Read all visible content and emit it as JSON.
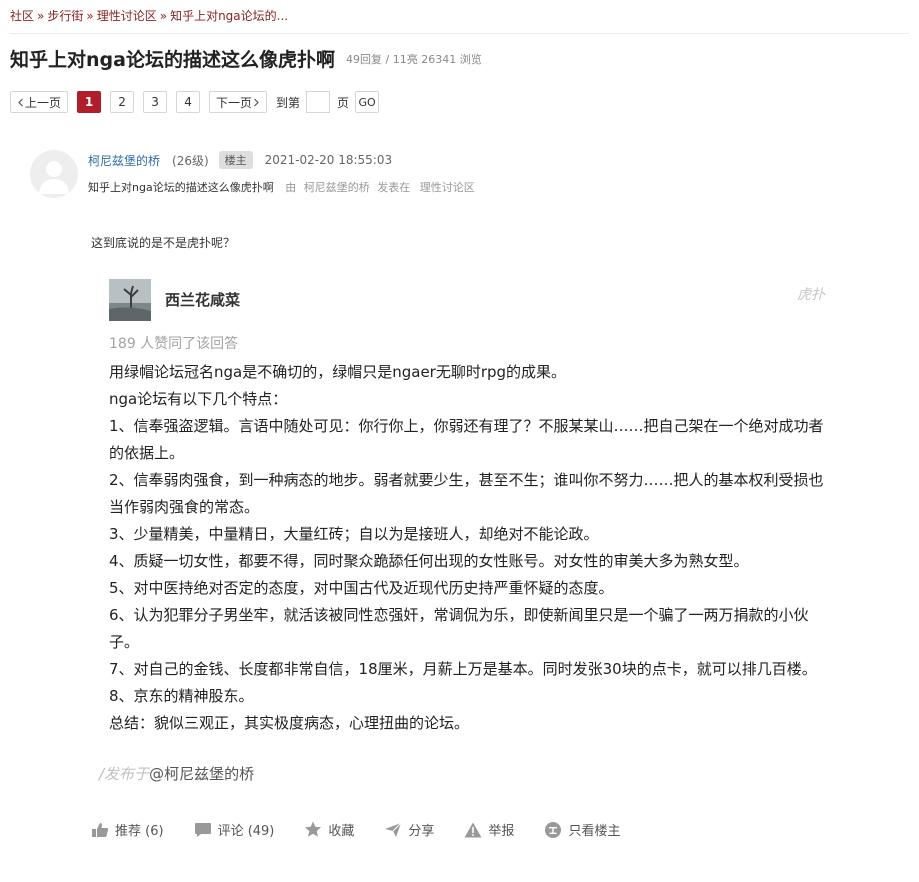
{
  "breadcrumb": {
    "items": [
      "社区",
      "步行街",
      "理性讨论区",
      "知乎上对nga论坛的..."
    ],
    "separator": "»"
  },
  "thread": {
    "title": "知乎上对nga论坛的描述这么像虎扑啊",
    "stats": "49回复 / 11亮 26341 浏览"
  },
  "pager": {
    "prev": "上一页",
    "pages": [
      "1",
      "2",
      "3",
      "4"
    ],
    "current": "1",
    "next": "下一页",
    "goto_label": "到第",
    "page_input": "",
    "page_unit": "页",
    "go": "GO"
  },
  "post": {
    "author": "柯尼兹堡的桥",
    "level": "(26级)",
    "badge": "楼主",
    "time": "2021-02-20 18:55:03",
    "sub_title": "知乎上对nga论坛的描述这么像虎扑啊",
    "by_label": "由",
    "sub_author": "柯尼兹堡的桥",
    "posted_in": "发表在",
    "board": "理性讨论区",
    "text": "这到底说的是不是虎扑呢？"
  },
  "embed": {
    "user": "西兰花咸菜",
    "watermark_top": "虎扑",
    "likes": "189 人赞同了该回答",
    "lines": [
      "用绿帽论坛冠名nga是不确切的，绿帽只是ngaer无聊时rpg的成果。",
      "nga论坛有以下几个特点：",
      "1、信奉强盗逻辑。言语中随处可见：你行你上，你弱还有理了？不服某某山……把自己架在一个绝对成功者的依据上。",
      "2、信奉弱肉强食，到一种病态的地步。弱者就要少生，甚至不生；谁叫你不努力……把人的基本权利受损也当作弱肉强食的常态。",
      "3、少量精美，中量精日，大量红砖；自以为是接班人，却绝对不能论政。",
      "4、质疑一切女性，都要不得，同时聚众跪舔任何出现的女性账号。对女性的审美大多为熟女型。",
      "5、对中医持绝对否定的态度，对中国古代及近现代历史持严重怀疑的态度。",
      "6、认为犯罪分子男坐牢，就活该被同性恋强奸，常调侃为乐，即使新闻里只是一个骗了一两万捐款的小伙子。",
      "7、对自己的金钱、长度都非常自信，18厘米，月薪上万是基本。同时发张30块的点卡，就可以排几百楼。",
      "8、京东的精神股东。",
      "总结：貌似三观正，其实极度病态，心理扭曲的论坛。"
    ],
    "watermark_faint": "/发布于",
    "watermark_user": "@柯尼兹堡的桥"
  },
  "actions": {
    "recommend": "推荐 (6)",
    "comment": "评论 (49)",
    "favorite": "收藏",
    "share": "分享",
    "report": "举报",
    "only_op": "只看楼主"
  },
  "colors": {
    "accent": "#b11e29",
    "breadcrumb": "#8a2321",
    "author_link": "#2f6ca9"
  }
}
